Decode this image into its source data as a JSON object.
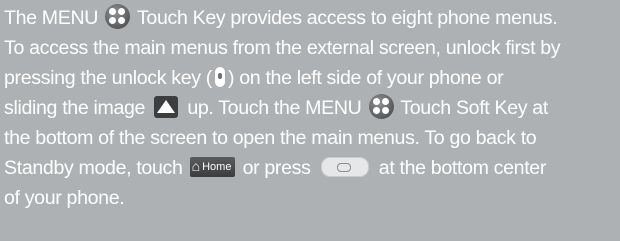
{
  "paragraph": {
    "l1": {
      "a": "The MENU",
      "b": "Touch Key provides access to eight phone menus."
    },
    "l2": {
      "a": "To access the main menus from the external screen, unlock first by"
    },
    "l3": {
      "a": "pressing the unlock key (",
      "b": ") on the left side of your phone or"
    },
    "l4": {
      "a": "sliding the image",
      "b": "up. Touch the MENU",
      "c": "Touch Soft Key at"
    },
    "l5": {
      "a": "the bottom of the screen to open the main menus. To go back to"
    },
    "l6": {
      "a": "Standby mode, touch",
      "b": "or press",
      "c": "at the bottom center"
    },
    "l7": {
      "a": "of your phone."
    }
  },
  "home_button": {
    "label": "Home"
  },
  "icons": {
    "menu": "menu-dots-icon",
    "unlock": "unlock-key-icon",
    "slide": "slide-up-arrow-icon",
    "home": "home-house-icon",
    "center_key": "center-key-icon"
  },
  "colors": {
    "background": "#aeb1b3",
    "text": "#ffffff",
    "icon_dark": "#3c3d3f"
  }
}
